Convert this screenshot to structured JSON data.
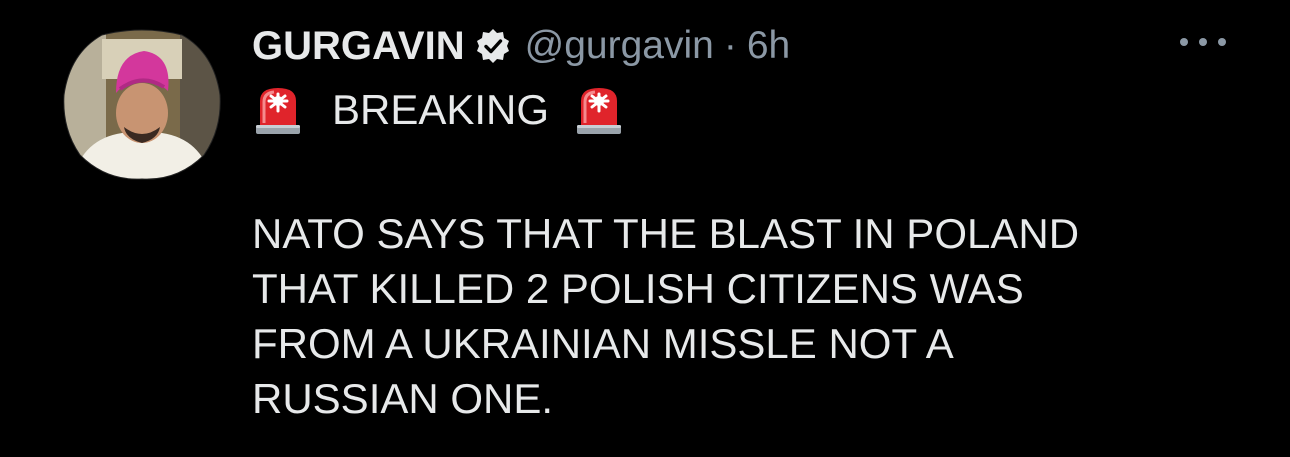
{
  "tweet": {
    "display_name": "GURGAVIN",
    "handle": "@gurgavin",
    "separator": "·",
    "time": "6h",
    "headline_emoji": "rotating-light-emoji",
    "headline": "BREAKING",
    "body_lines": [
      "NATO SAYS THAT THE BLAST IN POLAND",
      "THAT KILLED 2 POLISH CITIZENS WAS",
      "FROM A UKRAINIAN MISSLE NOT A",
      "RUSSIAN ONE."
    ]
  },
  "icons": {
    "verified": "verified-badge-icon",
    "more": "more-options-icon",
    "siren": "police-siren-icon"
  },
  "colors": {
    "background": "#000000",
    "text": "#e7e9ea",
    "secondary_text": "#8b98a5",
    "siren_red": "#e0242b"
  }
}
